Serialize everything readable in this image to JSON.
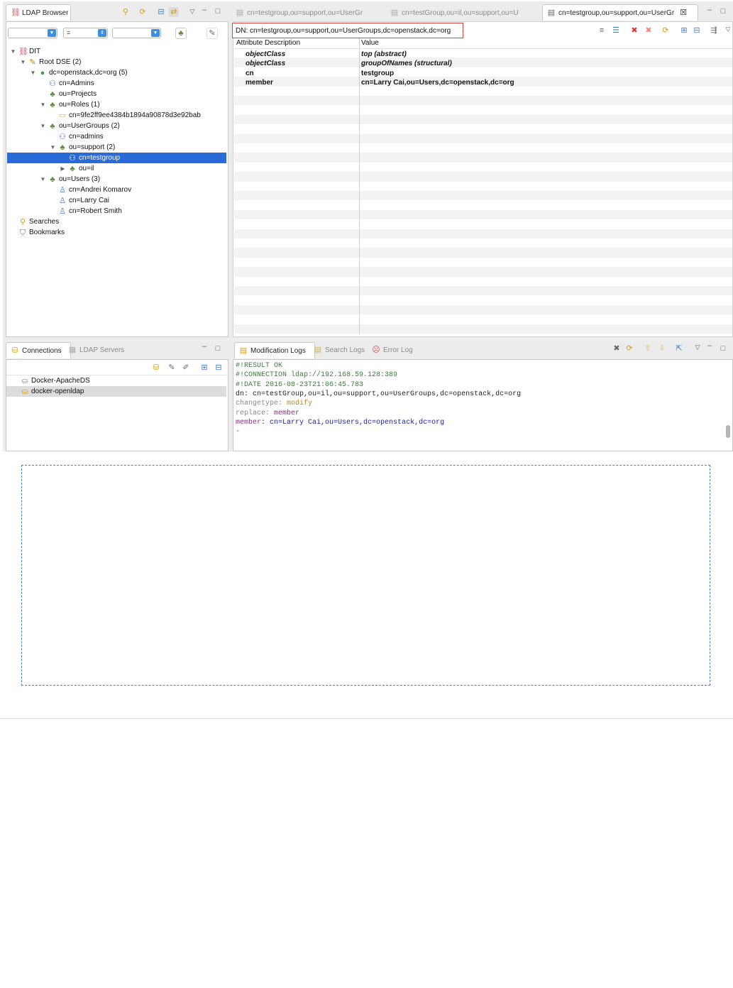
{
  "left_top_panel": {
    "tab_label": "LDAP Browser",
    "filter": {
      "attribute": "",
      "operator": "=",
      "value": ""
    },
    "tree": [
      {
        "label": "DIT",
        "level": 0,
        "expander": "down",
        "icon": "dit-icon"
      },
      {
        "label": "Root DSE (2)",
        "level": 1,
        "expander": "down",
        "icon": "root-dse-icon"
      },
      {
        "label": "dc=openstack,dc=org (5)",
        "level": 2,
        "expander": "down",
        "icon": "globe-icon"
      },
      {
        "label": "cn=Admins",
        "level": 3,
        "expander": "",
        "icon": "group-icon"
      },
      {
        "label": "ou=Projects",
        "level": 3,
        "expander": "",
        "icon": "ou-icon"
      },
      {
        "label": "ou=Roles (1)",
        "level": 3,
        "expander": "down",
        "icon": "ou-icon"
      },
      {
        "label": "cn=9fe2ff9ee4384b1894a90878d3e92bab",
        "level": 4,
        "expander": "",
        "icon": "folder-icon"
      },
      {
        "label": "ou=UserGroups (2)",
        "level": 3,
        "expander": "down",
        "icon": "ou-icon"
      },
      {
        "label": "cn=admins",
        "level": 4,
        "expander": "",
        "icon": "group-icon"
      },
      {
        "label": "ou=support (2)",
        "level": 4,
        "expander": "down",
        "icon": "ou-icon"
      },
      {
        "label": "cn=testgroup",
        "level": 5,
        "expander": "",
        "icon": "group-icon",
        "selected": true
      },
      {
        "label": "ou=il",
        "level": 5,
        "expander": "right",
        "icon": "ou-icon"
      },
      {
        "label": "ou=Users (3)",
        "level": 3,
        "expander": "down",
        "icon": "ou-icon"
      },
      {
        "label": "cn=Andrei Komarov",
        "level": 4,
        "expander": "",
        "icon": "person-icon"
      },
      {
        "label": "cn=Larry Cai",
        "level": 4,
        "expander": "",
        "icon": "person-icon"
      },
      {
        "label": "cn=Robert Smith",
        "level": 4,
        "expander": "",
        "icon": "person-icon"
      },
      {
        "label": "Searches",
        "level": 0,
        "expander": "",
        "icon": "searches-icon"
      },
      {
        "label": "Bookmarks",
        "level": 0,
        "expander": "",
        "icon": "bookmarks-icon"
      }
    ]
  },
  "editor": {
    "tabs": [
      {
        "label": "cn=testgroup,ou=support,ou=UserGr",
        "active": false
      },
      {
        "label": "cn=testGroup,ou=il,ou=support,ou=U",
        "active": false
      },
      {
        "label": "cn=testgroup,ou=support,ou=UserGr",
        "active": true
      }
    ],
    "close_symbol": "☒",
    "dn_label": "DN: cn=testgroup,ou=support,ou=UserGroups,dc=openstack,dc=org",
    "columns": [
      "Attribute Description",
      "Value"
    ],
    "rows": [
      {
        "attr": "objectClass",
        "value": "top (abstract)",
        "style": "italic"
      },
      {
        "attr": "objectClass",
        "value": "groupOfNames (structural)",
        "style": "italic"
      },
      {
        "attr": "cn",
        "value": "testgroup",
        "style": "bold"
      },
      {
        "attr": "member",
        "value": "cn=Larry Cai,ou=Users,dc=openstack,dc=org",
        "style": "bold"
      }
    ]
  },
  "connections_panel": {
    "tabs": [
      {
        "label": "Connections",
        "active": true
      },
      {
        "label": "LDAP Servers",
        "active": false
      }
    ],
    "items": [
      {
        "label": "Docker-ApacheDS",
        "selected": false
      },
      {
        "label": "docker-openldap",
        "selected": true
      }
    ]
  },
  "logs_panel": {
    "tabs": [
      {
        "label": "Modification Logs",
        "active": true
      },
      {
        "label": "Search Logs",
        "active": false
      },
      {
        "label": "Error Log",
        "active": false
      }
    ],
    "lines": [
      {
        "parts": [
          {
            "t": "#!RESULT OK",
            "c": "#3a7a3a"
          }
        ]
      },
      {
        "parts": [
          {
            "t": "#!CONNECTION ldap://192.168.59.128:389",
            "c": "#3a7a3a"
          }
        ]
      },
      {
        "parts": [
          {
            "t": "#!DATE 2016-08-23T21:06:45.783",
            "c": "#3a7a3a"
          }
        ]
      },
      {
        "parts": [
          {
            "t": "dn",
            "c": "#222"
          },
          {
            "t": ": cn=testGroup,ou=il,ou=support,ou=UserGroups,dc=openstack,dc=org",
            "c": "#222"
          }
        ]
      },
      {
        "parts": [
          {
            "t": "changetype",
            "c": "#888"
          },
          {
            "t": ": ",
            "c": "#888"
          },
          {
            "t": "modify",
            "c": "#b88a2a"
          }
        ]
      },
      {
        "parts": [
          {
            "t": "replace",
            "c": "#888"
          },
          {
            "t": ": ",
            "c": "#888"
          },
          {
            "t": "member",
            "c": "#8a2a8a"
          }
        ]
      },
      {
        "parts": [
          {
            "t": "member",
            "c": "#8a2a8a"
          },
          {
            "t": ": ",
            "c": "#333"
          },
          {
            "t": "cn=Larry Cai,ou=Users,dc=openstack,dc=org",
            "c": "#1a1aa8"
          }
        ]
      },
      {
        "parts": [
          {
            "t": "-",
            "c": "#d33"
          }
        ]
      }
    ]
  },
  "colors": {
    "selection": "#2a6ad8",
    "chrome_bg": "#ececec",
    "dn_border": "#e0443c",
    "dashed_box": "#4a7fc1"
  }
}
